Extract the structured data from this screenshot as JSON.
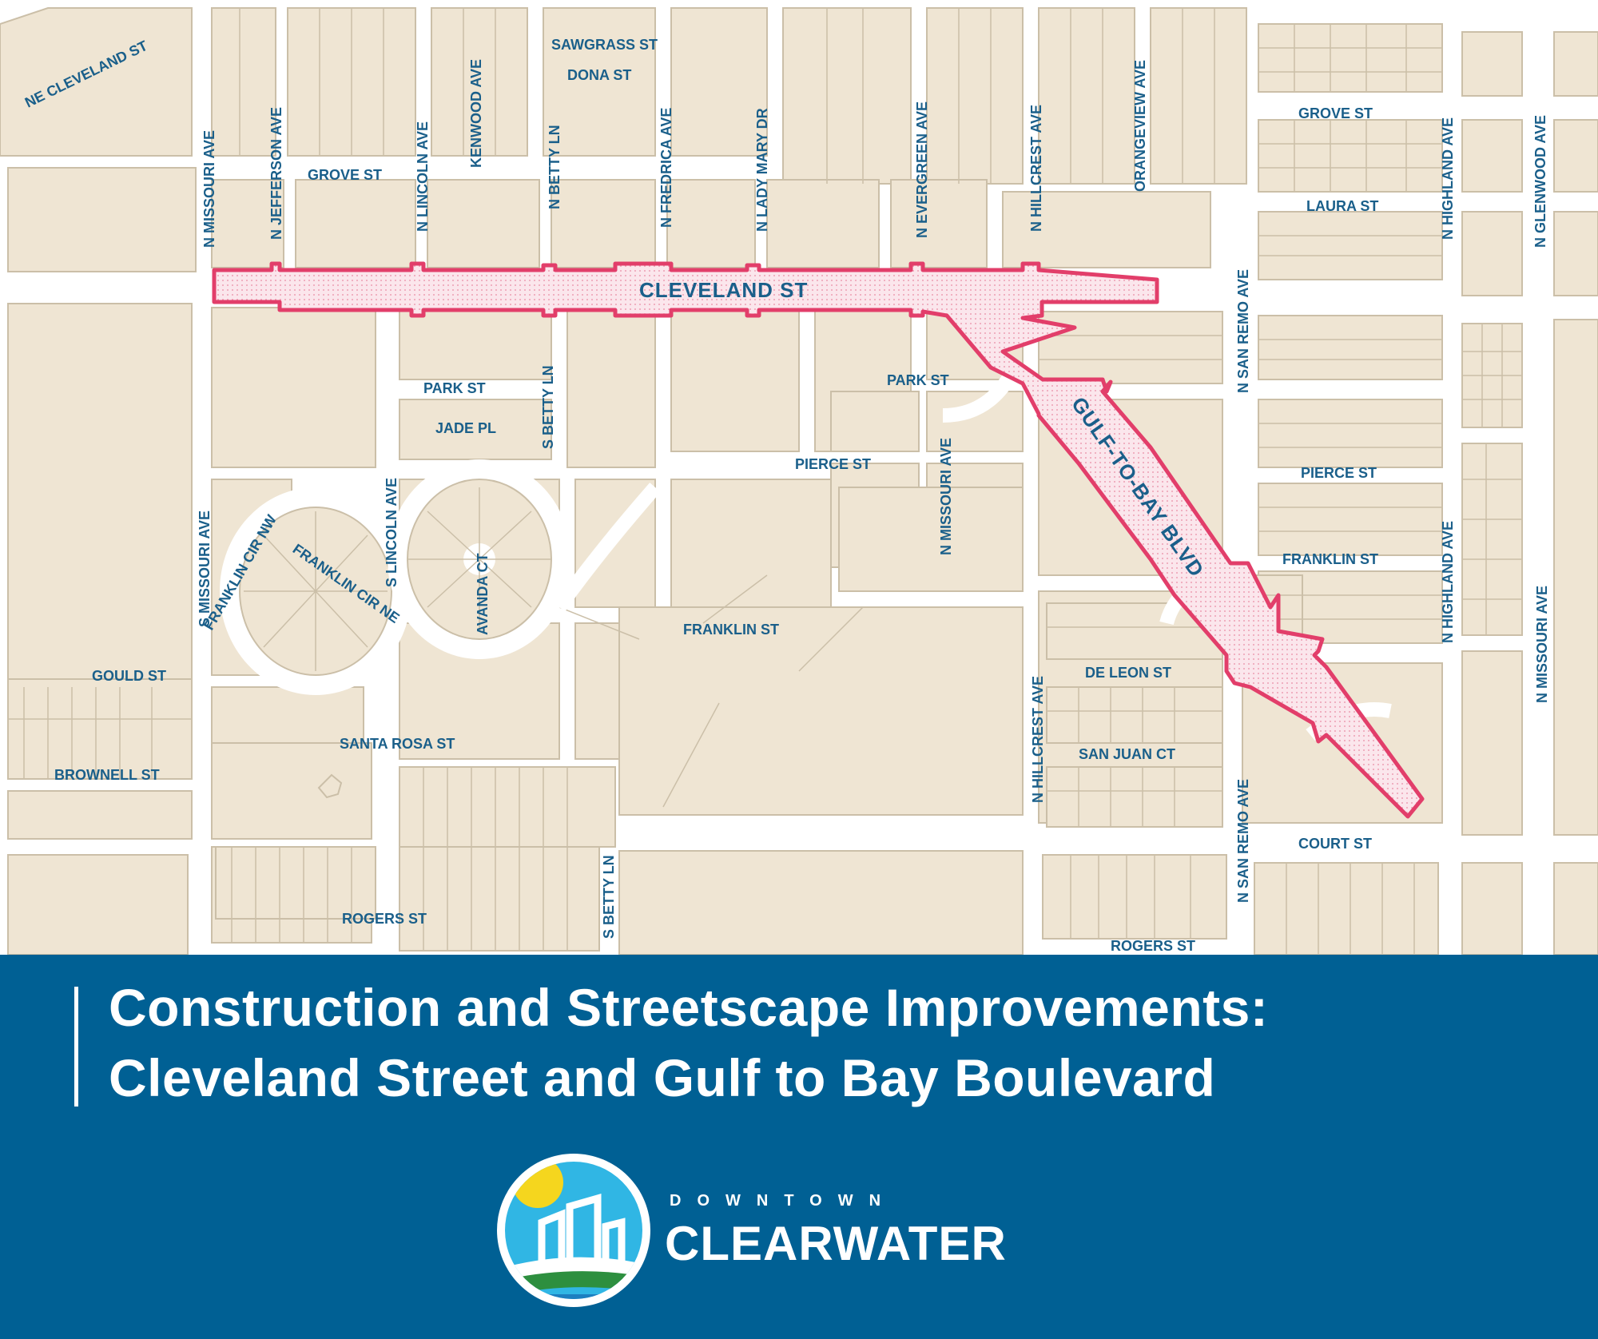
{
  "map": {
    "colors": {
      "land": "#efe5d3",
      "street": "#ffffff",
      "lot_line": "#cbbfa8",
      "highlight": "#e23e6a",
      "highlight_fill": "#f6d3dc",
      "label": "#1a5f8a"
    },
    "street_labels": {
      "ne_cleveland": "NE CLEVELAND ST",
      "sawgrass": "SAWGRASS ST",
      "dona": "DONA ST",
      "grove_w": "GROVE ST",
      "grove_e": "GROVE ST",
      "laura": "LAURA ST",
      "cleveland": "CLEVELAND ST",
      "park_w": "PARK ST",
      "park_e": "PARK ST",
      "jade": "JADE PL",
      "pierce_w": "PIERCE ST",
      "pierce_e": "PIERCE ST",
      "franklin_w": "FRANKLIN ST",
      "franklin_e": "FRANKLIN ST",
      "gould": "GOULD ST",
      "brownell": "BROWNELL ST",
      "santa_rosa": "SANTA ROSA ST",
      "de_leon": "DE LEON ST",
      "san_juan": "SAN JUAN CT",
      "court": "COURT ST",
      "rogers_w": "ROGERS ST",
      "rogers_e": "ROGERS ST",
      "gulf_to_bay": "GULF-TO-BAY BLVD",
      "franklin_cir_nw": "FRANKLIN CIR NW",
      "franklin_cir_ne": "FRANKLIN CIR NE",
      "n_missouri": "N MISSOURI AVE",
      "n_jefferson": "N JEFFERSON AVE",
      "n_lincoln": "N LINCOLN AVE",
      "kenwood": "KENWOOD AVE",
      "n_betty": "N BETTY LN",
      "n_fredrica": "N FREDRICA AVE",
      "n_lady_mary": "N LADY MARY DR",
      "n_evergreen": "N EVERGREEN AVE",
      "n_hillcrest_top": "N HILLCREST AVE",
      "orangeview": "ORANGEVIEW AVE",
      "n_highland_top": "N HIGHLAND AVE",
      "n_glenwood": "N GLENWOOD AVE",
      "n_san_remo_top": "N SAN REMO AVE",
      "s_missouri": "S MISSOURI AVE",
      "s_lincoln": "S LINCOLN AVE",
      "avanda": "AVANDA CT",
      "s_betty_mid": "S BETTY LN",
      "n_missouri_mid": "N MISSOURI AVE",
      "n_highland_bottom": "N HIGHLAND AVE",
      "n_missouri_east": "N MISSOURI AVE",
      "n_hillcrest_bottom": "N HILLCREST AVE",
      "n_san_remo_bottom1": "N SAN REMO AVE",
      "n_san_remo_bottom2": "N SAN REMO AVE",
      "s_betty_bottom": "S BETTY LN"
    }
  },
  "banner": {
    "title_line1": "Construction and Streetscape Improvements:",
    "title_line2": "Cleveland Street and Gulf to Bay Boulevard",
    "background": "#006094"
  },
  "logo": {
    "brand_top": "DOWNTOWN",
    "brand_main": "CLEARWATER",
    "colors": {
      "sun": "#f5d61e",
      "sky": "#30b6e4",
      "wave": "#2d8f3f",
      "water": "#1d7fc0"
    }
  }
}
